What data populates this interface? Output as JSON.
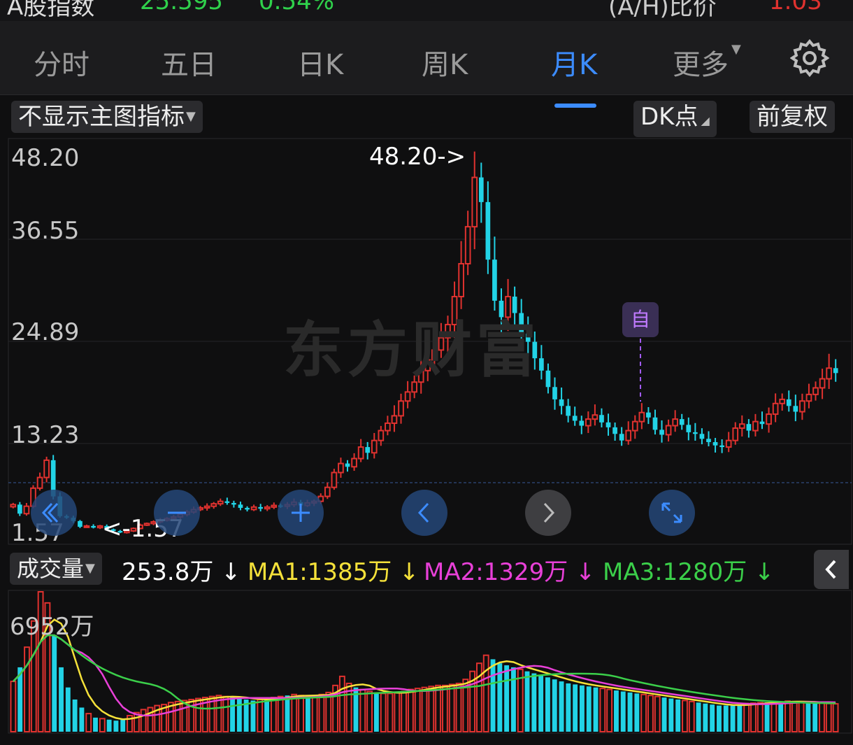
{
  "header": {
    "left_text": "A股指数",
    "left_value": "25.595",
    "left_change": "0.54%",
    "right_text": "(A/H)比价",
    "right_value": "1.03"
  },
  "tabs": [
    {
      "label": "分时"
    },
    {
      "label": "五日"
    },
    {
      "label": "日K"
    },
    {
      "label": "周K"
    },
    {
      "label": "月K",
      "active": true
    },
    {
      "label": "更多"
    }
  ],
  "toolbar": {
    "indicator_label": "不显示主图指标",
    "dk_label": "DK点",
    "adjust_label": "前复权"
  },
  "main_chart": {
    "y_ticks": [
      "48.20",
      "36.55",
      "24.89",
      "13.23",
      "1.57"
    ],
    "max_annotation": "48.20->",
    "min_annotation": "<-1.57",
    "watermark": "东方财富",
    "self_marker": "自"
  },
  "volume_bar": {
    "label": "成交量",
    "volume": "253.8万",
    "ma1": "MA1:1385万",
    "ma2": "MA2:1329万",
    "ma3": "MA3:1280万",
    "arrow": "↓"
  },
  "volume_chart": {
    "max_label": "6952万"
  },
  "colors": {
    "up": "#e0322f",
    "down": "#22d3e6",
    "ma1": "#f5e13a",
    "ma2": "#e840d8",
    "ma3": "#3bcf4a",
    "accent": "#3c8cff"
  },
  "chart_data": {
    "type": "candlestick",
    "ylim": [
      1.57,
      48.2
    ],
    "closes": [
      5.2,
      4.1,
      5.0,
      7.2,
      8.5,
      10.6,
      6.2,
      3.8,
      3.6,
      3.2,
      2.5,
      2.6,
      2.4,
      2.6,
      2.2,
      2.0,
      1.8,
      2.0,
      2.3,
      2.7,
      2.9,
      3.1,
      3.3,
      3.5,
      3.7,
      4.0,
      4.3,
      4.6,
      4.8,
      5.0,
      5.3,
      5.6,
      5.4,
      5.2,
      4.8,
      4.6,
      4.9,
      4.7,
      4.9,
      5.1,
      5.0,
      5.2,
      5.5,
      5.1,
      5.4,
      5.6,
      6.2,
      7.3,
      9.1,
      10.2,
      9.8,
      10.8,
      12.2,
      11.5,
      13.0,
      14.2,
      15.1,
      16.0,
      17.8,
      18.9,
      20.1,
      21.5,
      22.8,
      24.0,
      25.5,
      27.1,
      30.5,
      34.5,
      39.0,
      45.0,
      42.0,
      35.0,
      30.0,
      28.0,
      30.5,
      28.5,
      26.0,
      25.0,
      23.0,
      21.5,
      19.5,
      18.0,
      17.2,
      16.0,
      15.4,
      14.8,
      15.6,
      16.1,
      15.2,
      14.6,
      13.8,
      13.0,
      14.2,
      15.3,
      16.4,
      15.8,
      14.3,
      13.7,
      14.8,
      15.6,
      14.9,
      14.0,
      13.8,
      13.2,
      12.8,
      12.4,
      12.2,
      13.0,
      14.5,
      15.0,
      14.2,
      15.3,
      15.0,
      16.2,
      17.5,
      18.0,
      17.2,
      16.5,
      17.8,
      18.6,
      19.4,
      20.5,
      21.8,
      21.2
    ],
    "volumes_wan": [
      2500,
      3200,
      4200,
      5500,
      6952,
      6400,
      4800,
      3200,
      2200,
      1600,
      1200,
      900,
      700,
      650,
      600,
      550,
      600,
      800,
      950,
      1100,
      1200,
      1300,
      1350,
      1450,
      1500,
      1550,
      1600,
      1650,
      1700,
      1750,
      1800,
      1750,
      1700,
      1650,
      1600,
      1550,
      1600,
      1650,
      1700,
      1750,
      1800,
      1850,
      1800,
      1750,
      1800,
      1850,
      1950,
      2300,
      2750,
      2400,
      2200,
      2100,
      2000,
      1950,
      1900,
      1900,
      1950,
      2000,
      2100,
      2150,
      2200,
      2250,
      2300,
      2300,
      2350,
      2400,
      2600,
      3000,
      3400,
      3800,
      3600,
      3400,
      3300,
      3200,
      3100,
      3000,
      2900,
      2800,
      2700,
      2600,
      2500,
      2400,
      2350,
      2300,
      2250,
      2200,
      2150,
      2100,
      2050,
      2000,
      1950,
      1900,
      1850,
      1800,
      1750,
      1700,
      1650,
      1600,
      1550,
      1500,
      1450,
      1400,
      1350,
      1300,
      1300,
      1300,
      1350,
      1400,
      1420,
      1440,
      1460,
      1480,
      1500,
      1520,
      1500,
      1480,
      1460,
      1440,
      1420,
      1400,
      1385
    ],
    "ma_volume": {
      "ma1": "1385万",
      "ma2": "1329万",
      "ma3": "1280万"
    }
  }
}
